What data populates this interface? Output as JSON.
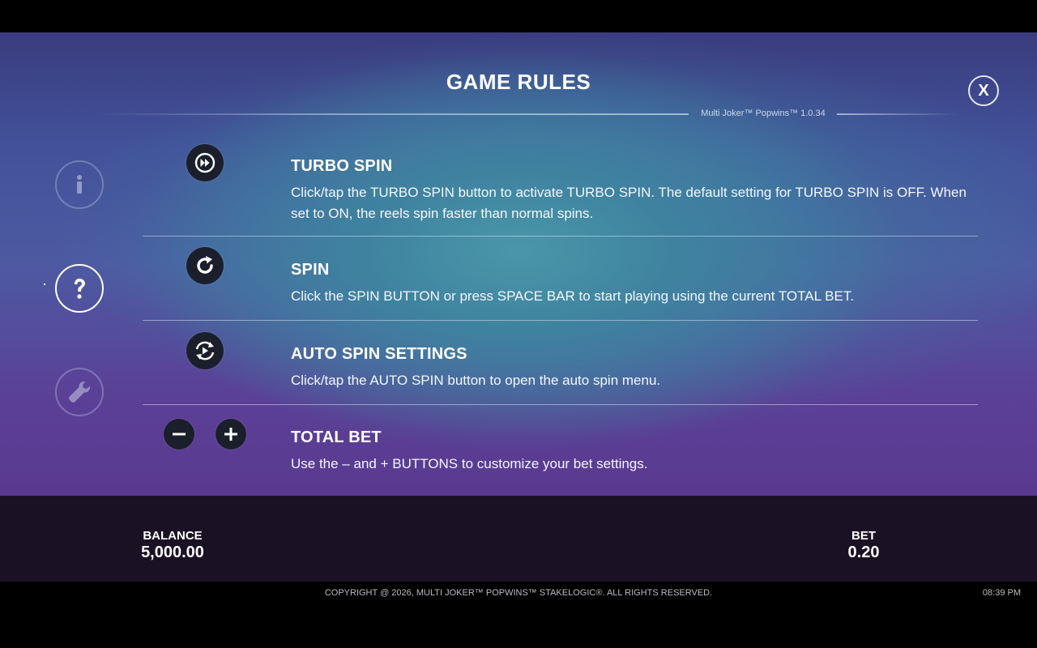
{
  "header": {
    "title": "GAME RULES",
    "close_label": "X",
    "version": "Multi Joker™ Popwins™ 1.0.34"
  },
  "sidebar": {
    "items": [
      {
        "name": "info",
        "icon": "info-icon",
        "state": "inactive"
      },
      {
        "name": "game-rules",
        "icon": "question-icon",
        "state": "active"
      },
      {
        "name": "settings",
        "icon": "wrench-icon",
        "state": "inactive"
      }
    ]
  },
  "sections": [
    {
      "title": "TURBO SPIN",
      "icon": "turbo-spin-icon",
      "text": "Click/tap the TURBO SPIN button to activate TURBO SPIN. The default setting for TURBO SPIN is OFF. When set to ON, the reels spin faster than normal spins."
    },
    {
      "title": "SPIN",
      "icon": "spin-icon",
      "text": "Click the SPIN BUTTON or press SPACE BAR to start playing using the current TOTAL BET."
    },
    {
      "title": "AUTO SPIN SETTINGS",
      "icon": "auto-spin-icon",
      "text": "Click/tap the AUTO SPIN button to open the auto spin menu."
    },
    {
      "title": "TOTAL BET",
      "icon": "minus-plus-icons",
      "text": "Use the – and + BUTTONS to customize your bet settings."
    }
  ],
  "footer": {
    "balance_label": "BALANCE",
    "balance_value": "5,000.00",
    "bet_label": "BET",
    "bet_value": "0.20",
    "copyright": "COPYRIGHT @ 2026, MULTI JOKER™ POPWINS™ STAKELOGIC®. ALL RIGHTS RESERVED.",
    "time": "08:39 PM"
  },
  "colors": {
    "icon_bg": "#1a1f2b",
    "footer_bg": "#1a1224",
    "accent": "#ffffff"
  }
}
